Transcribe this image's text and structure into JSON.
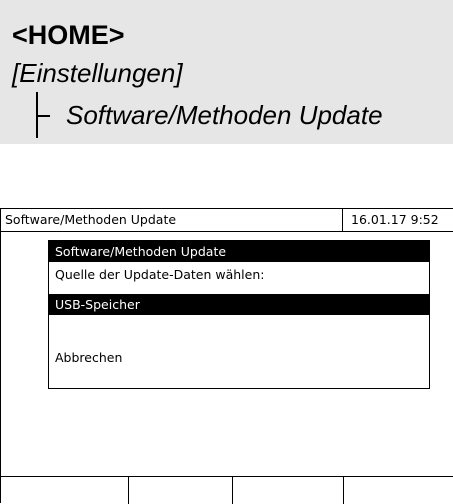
{
  "nav": {
    "home": "<HOME>",
    "menu": "[Einstellungen]",
    "submenu": "Software/Methoden Update"
  },
  "screen": {
    "title": "Software/Methoden Update",
    "datetime": "16.01.17  9:52"
  },
  "dialog": {
    "header": "Software/Methoden Update",
    "prompt": "Quelle der Update-Daten wählen:",
    "selected_option": "USB-Speicher",
    "cancel": "Abbrechen"
  },
  "softkeys": [
    "",
    "",
    "",
    ""
  ],
  "colors": {
    "nav_background": "#e6e6e6",
    "highlight": "#000000",
    "highlight_text": "#ffffff"
  }
}
